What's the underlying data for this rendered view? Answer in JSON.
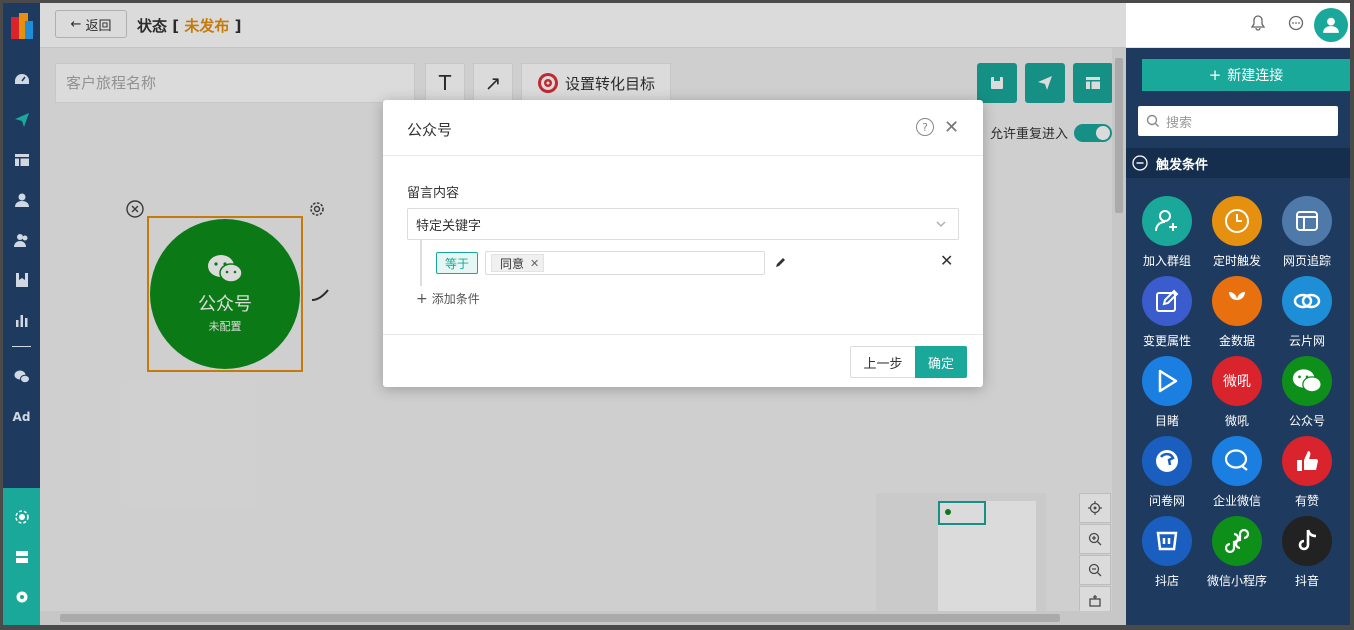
{
  "topbar": {
    "back_label": "返回",
    "status_prefix": "状态",
    "status_value": "未发布"
  },
  "toolbar": {
    "name_placeholder": "客户旅程名称",
    "goal_label": "设置转化目标",
    "repeat_label": "允许重复进入"
  },
  "node": {
    "title": "公众号",
    "subtitle": "未配置"
  },
  "panel": {
    "new_connection": "新建连接",
    "search_placeholder": "搜索",
    "section_title": "触发条件",
    "apps": [
      {
        "label": "加入群组",
        "icon": "user-plus-icon",
        "color": "#1aa89a"
      },
      {
        "label": "定时触发",
        "icon": "clock-icon",
        "color": "#e6900f"
      },
      {
        "label": "网页追踪",
        "icon": "webpage-icon",
        "color": "#4f79a8"
      },
      {
        "label": "变更属性",
        "icon": "edit-icon",
        "color": "#3b5ccc"
      },
      {
        "label": "金数据",
        "icon": "jinshuju-icon",
        "color": "#e8700f"
      },
      {
        "label": "云片网",
        "icon": "yunpian-icon",
        "color": "#1e8fd6"
      },
      {
        "label": "目睹",
        "icon": "play-icon",
        "color": "#1a7fe0"
      },
      {
        "label": "微吼",
        "icon": "weihou-icon",
        "color": "#d9232d",
        "text": "微吼"
      },
      {
        "label": "公众号",
        "icon": "wechat-icon",
        "color": "#0d8f1a"
      },
      {
        "label": "问卷网",
        "icon": "wenjuan-icon",
        "color": "#1a5fbf"
      },
      {
        "label": "企业微信",
        "icon": "wecom-icon",
        "color": "#1a7fe0"
      },
      {
        "label": "有赞",
        "icon": "thumbs-up-icon",
        "color": "#d9232d"
      },
      {
        "label": "抖店",
        "icon": "doudian-icon",
        "color": "#1a5fbf"
      },
      {
        "label": "微信小程序",
        "icon": "miniprogram-icon",
        "color": "#0d8f1a"
      },
      {
        "label": "抖音",
        "icon": "tiktok-icon",
        "color": "#222"
      }
    ]
  },
  "modal": {
    "title": "公众号",
    "field_label": "留言内容",
    "select_value": "特定关键字",
    "operator": "等于",
    "keyword": "同意",
    "add_condition": "添加条件",
    "prev_label": "上一步",
    "ok_label": "确定"
  }
}
